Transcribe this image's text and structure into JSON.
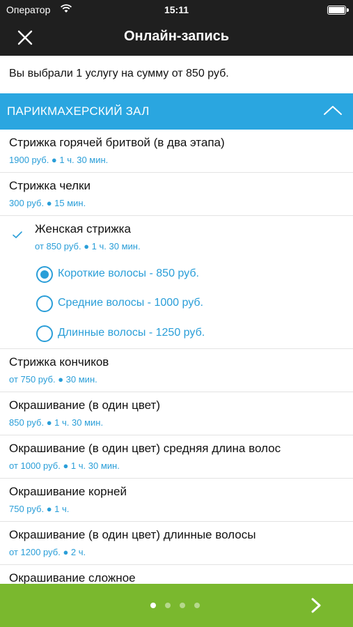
{
  "status": {
    "carrier": "Оператор",
    "time": "15:11",
    "battery_level": 1.0
  },
  "nav": {
    "title": "Онлайн-запись"
  },
  "summary": {
    "text": "Вы выбрали 1 услугу на сумму от 850 руб."
  },
  "section": {
    "title": "ПАРИКМАХЕРСКИЙ ЗАЛ",
    "expanded": true
  },
  "services": [
    {
      "name": "Стрижка горячей бритвой (в два этапа)",
      "meta": "1900 руб. ● 1 ч. 30 мин."
    },
    {
      "name": "Стрижка челки",
      "meta": "300 руб. ● 15 мин."
    },
    {
      "name": "Женская стрижка",
      "meta": "от 850 руб. ● 1 ч. 30 мин.",
      "selected": true,
      "options": [
        {
          "label": "Короткие волосы - 850 руб.",
          "selected": true
        },
        {
          "label": "Средние волосы - 1000 руб.",
          "selected": false
        },
        {
          "label": "Длинные волосы - 1250 руб.",
          "selected": false
        }
      ]
    },
    {
      "name": "Стрижка кончиков",
      "meta": "от 750 руб. ● 30 мин."
    },
    {
      "name": "Окрашивание (в один цвет)",
      "meta": "850 руб. ● 1 ч. 30 мин."
    },
    {
      "name": "Окрашивание (в один цвет) средняя длина волос",
      "meta": "от 1000 руб. ● 1 ч. 30 мин."
    },
    {
      "name": "Окрашивание корней",
      "meta": "750 руб. ● 1 ч."
    },
    {
      "name": "Окрашивание (в один цвет) длинные волосы",
      "meta": "от 1200 руб. ● 2 ч."
    },
    {
      "name": "Окрашивание сложное",
      "meta": ""
    }
  ],
  "pager": {
    "pages": 4,
    "current": 1
  },
  "colors": {
    "accent": "#2aa6e0",
    "link": "#2a9ed8",
    "bar": "#1f1f1f",
    "bottom": "#7ab82e"
  },
  "icons": {
    "close": "close-icon",
    "collapse": "chevron-up-icon",
    "check": "check-icon",
    "next": "chevron-right-icon",
    "wifi": "wifi-icon",
    "battery": "battery-icon"
  }
}
